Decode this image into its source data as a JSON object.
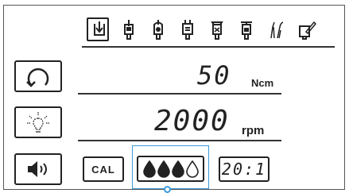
{
  "tool_icons": [
    {
      "name": "contra-angle-handpiece-selected-icon",
      "selected": true
    },
    {
      "name": "handpiece-1-icon",
      "selected": false
    },
    {
      "name": "handpiece-2-icon",
      "selected": false
    },
    {
      "name": "handpiece-3-icon",
      "selected": false
    },
    {
      "name": "handpiece-4-icon",
      "selected": false
    },
    {
      "name": "handpiece-5-icon",
      "selected": false
    },
    {
      "name": "dental-instruments-icon",
      "selected": false
    },
    {
      "name": "handpiece-edit-icon",
      "selected": false
    }
  ],
  "torque": {
    "value": "50",
    "unit": "Ncm"
  },
  "speed": {
    "value": "2000",
    "unit": "rpm"
  },
  "buttons": {
    "cal_label": "CAL",
    "ratio_label": "20:1"
  },
  "coolant": {
    "level": 3,
    "max": 4,
    "color": "#222222"
  },
  "highlight_color": "#3a9ad9",
  "side_icons": [
    "rotation-direction-icon",
    "light-bulb-icon",
    "speaker-volume-icon"
  ]
}
